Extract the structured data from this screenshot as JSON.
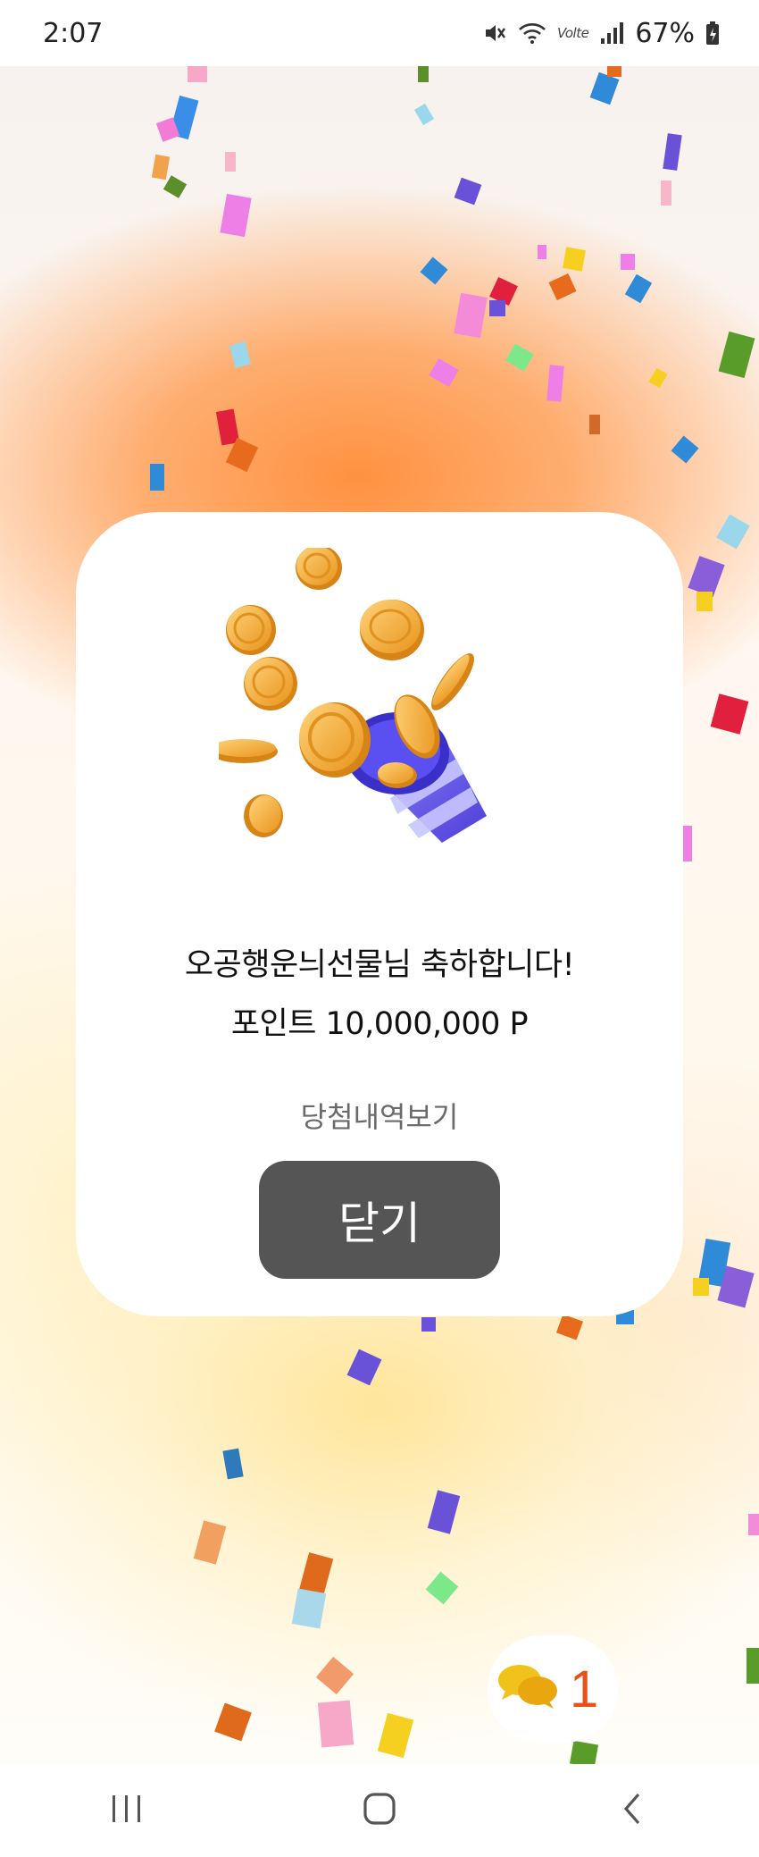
{
  "status_bar": {
    "time": "2:07",
    "network_label": "Volte",
    "battery": "67%"
  },
  "modal": {
    "congrats": "오공행운늬선물님 축하합니다!",
    "points": "포인트 10,000,000 P",
    "history_link": "당첨내역보기",
    "close_label": "닫기"
  },
  "chat": {
    "icon": "chat-bubbles-icon",
    "count": "1"
  },
  "nav": {
    "recent_icon": "recent-apps-icon",
    "home_icon": "home-icon",
    "back_icon": "back-icon"
  },
  "colors": {
    "accent_orange": "#e8501a",
    "button_dark": "#555555"
  }
}
